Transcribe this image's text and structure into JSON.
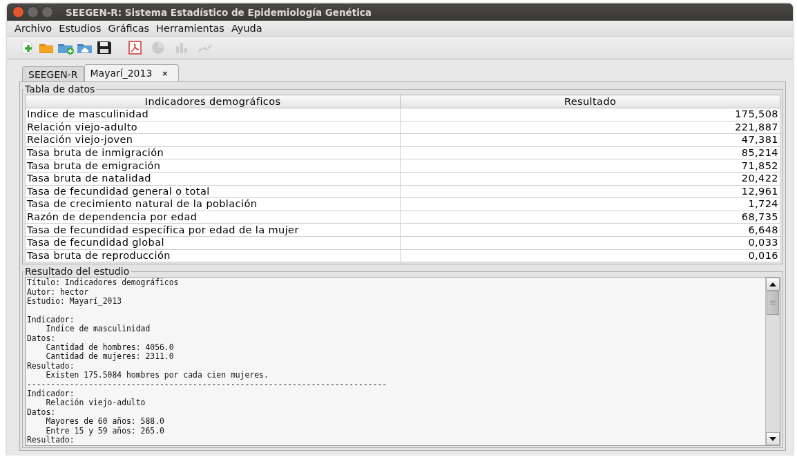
{
  "window": {
    "title": "SEEGEN-R: Sistema Estadístico de Epidemiología Genética"
  },
  "menu": [
    "Archivo",
    "Estudios",
    "Gráficas",
    "Herramientas",
    "Ayuda"
  ],
  "toolbar": [
    {
      "kind": "new",
      "disabled": false
    },
    {
      "kind": "open",
      "disabled": false
    },
    {
      "kind": "add-folder",
      "disabled": false
    },
    {
      "kind": "home-folder",
      "disabled": false
    },
    {
      "kind": "save",
      "disabled": false
    },
    {
      "kind": "pdf",
      "disabled": false
    },
    {
      "kind": "pie",
      "disabled": true
    },
    {
      "kind": "bars",
      "disabled": true
    },
    {
      "kind": "scatter",
      "disabled": true
    }
  ],
  "tabs": [
    {
      "label": "SEEGEN-R",
      "selected": false
    },
    {
      "label": "Mayarí_2013",
      "selected": true,
      "close": "×"
    }
  ],
  "table_panel": {
    "title": "Tabla de datos",
    "columns": [
      "Indicadores demográficos",
      "Resultado"
    ],
    "rows": [
      [
        "Indice de masculinidad",
        "175,508"
      ],
      [
        "Relación viejo-adulto",
        "221,887"
      ],
      [
        "Relación viejo-joven",
        "47,381"
      ],
      [
        "Tasa bruta de inmigración",
        "85,214"
      ],
      [
        "Tasa bruta de emigración",
        "71,852"
      ],
      [
        "Tasa bruta de natalidad",
        "20,422"
      ],
      [
        "Tasa de fecundidad general o total",
        "12,961"
      ],
      [
        "Tasa de crecimiento natural de la población",
        "1,724"
      ],
      [
        "Razón de dependencia por edad",
        "68,735"
      ],
      [
        "Tasa de fecundidad específica por edad de la mujer",
        "6,648"
      ],
      [
        "Tasa de fecundidad global",
        "0,033"
      ],
      [
        "Tasa bruta de reproducción",
        "0,016"
      ]
    ]
  },
  "result_panel": {
    "title": "Resultado del estudio",
    "paragraphs": [
      [
        "Título: Indicadores demográficos",
        "Autor: hector",
        "Estudio: Mayarí_2013"
      ],
      [
        "Indicador:",
        "    Indice de masculinidad",
        "Datos:",
        "    Cantidad de hombres: 4056.0",
        "    Cantidad de mujeres: 2311.0",
        "Resultado:",
        "    Existen 175.5084 hombres por cada cien mujeres.",
        "----------------------------------------------------------------------------",
        "Indicador:",
        "    Relación viejo-adulto",
        "Datos:",
        "    Mayores de 60 años: 588.0",
        "    Entre 15 y 59 años: 265.0",
        "Resultado:"
      ]
    ]
  }
}
